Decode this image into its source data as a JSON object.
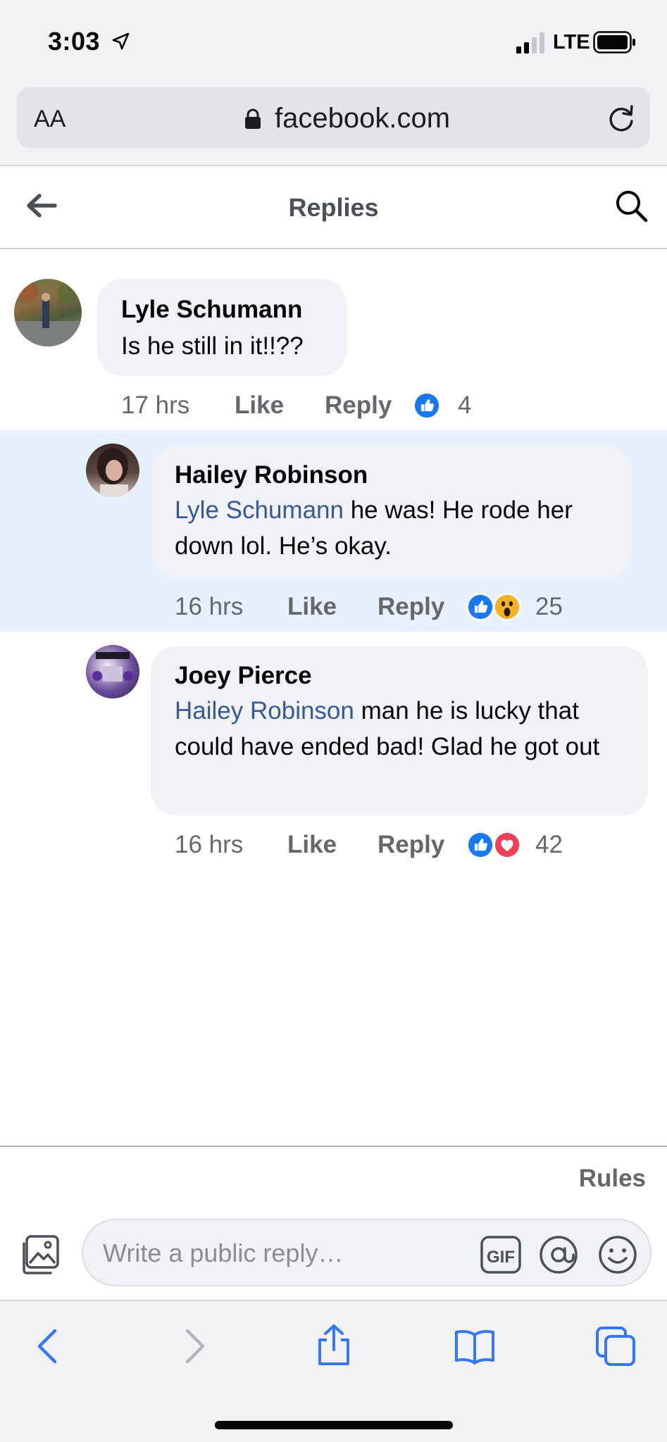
{
  "status": {
    "time": "3:03",
    "network": "LTE"
  },
  "browser": {
    "text_size_label": "AA",
    "domain": "facebook.com"
  },
  "header": {
    "title": "Replies"
  },
  "comments": [
    {
      "author": "Lyle Schumann",
      "mention": "",
      "text": "Is he still in it!!??",
      "time": "17 hrs",
      "like_label": "Like",
      "reply_label": "Reply",
      "reactions": [
        "like"
      ],
      "reaction_count": "4",
      "highlighted": false
    },
    {
      "author": "Hailey Robinson",
      "mention": "Lyle Schumann",
      "text": "he was! He rode her down lol. He’s okay.",
      "time": "16 hrs",
      "like_label": "Like",
      "reply_label": "Reply",
      "reactions": [
        "like",
        "wow"
      ],
      "reaction_count": "25",
      "highlighted": true
    },
    {
      "author": "Joey Pierce",
      "mention": "Hailey Robinson",
      "text": "man he is lucky that could have ended bad! Glad he got out",
      "time": "16 hrs",
      "like_label": "Like",
      "reply_label": "Reply",
      "reactions": [
        "like",
        "love"
      ],
      "reaction_count": "42",
      "highlighted": false
    }
  ],
  "footer": {
    "rules_label": "Rules",
    "reply_placeholder": "Write a public reply…",
    "gif_label": "GIF"
  },
  "colors": {
    "mention": "#385898",
    "highlight": "#e7f0fd",
    "like_blue": "#1877f2",
    "love_red": "#f33e58",
    "wow_yellow": "#f7b125",
    "safari_blue": "#3478f6"
  }
}
